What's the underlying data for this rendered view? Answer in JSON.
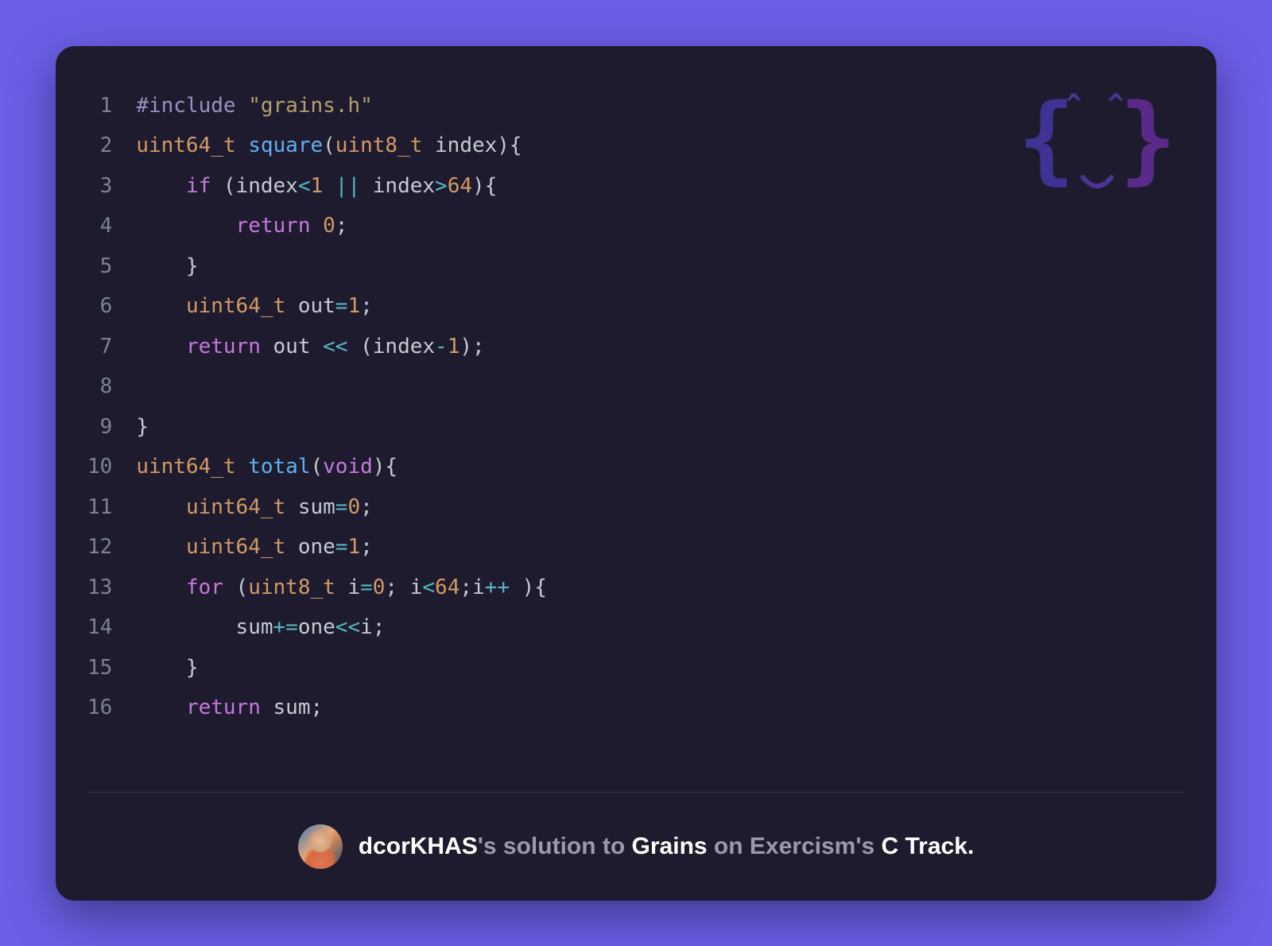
{
  "code": {
    "lines": [
      {
        "n": 1,
        "tokens": [
          [
            "#include ",
            "pre"
          ],
          [
            "\"grains.h\"",
            "str"
          ]
        ]
      },
      {
        "n": 2,
        "tokens": [
          [
            "uint64_t",
            "type"
          ],
          [
            " ",
            "punc"
          ],
          [
            "square",
            "func"
          ],
          [
            "(",
            "punc"
          ],
          [
            "uint8_t",
            "type"
          ],
          [
            " index){",
            "punc"
          ]
        ]
      },
      {
        "n": 3,
        "tokens": [
          [
            "    ",
            "punc"
          ],
          [
            "if",
            "key"
          ],
          [
            " (index",
            "punc"
          ],
          [
            "<",
            "op"
          ],
          [
            "1",
            "num"
          ],
          [
            " ",
            "punc"
          ],
          [
            "||",
            "op"
          ],
          [
            " index",
            "punc"
          ],
          [
            ">",
            "op"
          ],
          [
            "64",
            "num"
          ],
          [
            "){",
            "punc"
          ]
        ]
      },
      {
        "n": 4,
        "tokens": [
          [
            "        ",
            "punc"
          ],
          [
            "return",
            "key"
          ],
          [
            " ",
            "punc"
          ],
          [
            "0",
            "num"
          ],
          [
            ";",
            "punc"
          ]
        ]
      },
      {
        "n": 5,
        "tokens": [
          [
            "    }",
            "punc"
          ]
        ]
      },
      {
        "n": 6,
        "tokens": [
          [
            "    ",
            "punc"
          ],
          [
            "uint64_t",
            "type"
          ],
          [
            " out",
            "punc"
          ],
          [
            "=",
            "op"
          ],
          [
            "1",
            "num"
          ],
          [
            ";",
            "punc"
          ]
        ]
      },
      {
        "n": 7,
        "tokens": [
          [
            "    ",
            "punc"
          ],
          [
            "return",
            "key"
          ],
          [
            " out ",
            "punc"
          ],
          [
            "<<",
            "op"
          ],
          [
            " (index",
            "punc"
          ],
          [
            "-",
            "op"
          ],
          [
            "1",
            "num"
          ],
          [
            ");",
            "punc"
          ]
        ]
      },
      {
        "n": 8,
        "tokens": [
          [
            "",
            "punc"
          ]
        ]
      },
      {
        "n": 9,
        "tokens": [
          [
            "}",
            "punc"
          ]
        ]
      },
      {
        "n": 10,
        "tokens": [
          [
            "uint64_t",
            "type"
          ],
          [
            " ",
            "punc"
          ],
          [
            "total",
            "func"
          ],
          [
            "(",
            "punc"
          ],
          [
            "void",
            "key"
          ],
          [
            "){",
            "punc"
          ]
        ]
      },
      {
        "n": 11,
        "tokens": [
          [
            "    ",
            "punc"
          ],
          [
            "uint64_t",
            "type"
          ],
          [
            " sum",
            "punc"
          ],
          [
            "=",
            "op"
          ],
          [
            "0",
            "num"
          ],
          [
            ";",
            "punc"
          ]
        ]
      },
      {
        "n": 12,
        "tokens": [
          [
            "    ",
            "punc"
          ],
          [
            "uint64_t",
            "type"
          ],
          [
            " one",
            "punc"
          ],
          [
            "=",
            "op"
          ],
          [
            "1",
            "num"
          ],
          [
            ";",
            "punc"
          ]
        ]
      },
      {
        "n": 13,
        "tokens": [
          [
            "    ",
            "punc"
          ],
          [
            "for",
            "key"
          ],
          [
            " (",
            "punc"
          ],
          [
            "uint8_t",
            "type"
          ],
          [
            " i",
            "punc"
          ],
          [
            "=",
            "op"
          ],
          [
            "0",
            "num"
          ],
          [
            "; i",
            "punc"
          ],
          [
            "<",
            "op"
          ],
          [
            "64",
            "num"
          ],
          [
            ";i",
            "punc"
          ],
          [
            "++",
            "op"
          ],
          [
            " ){",
            "punc"
          ]
        ]
      },
      {
        "n": 14,
        "tokens": [
          [
            "        sum",
            "punc"
          ],
          [
            "+=",
            "op"
          ],
          [
            "one",
            "punc"
          ],
          [
            "<<",
            "op"
          ],
          [
            "i;",
            "punc"
          ]
        ]
      },
      {
        "n": 15,
        "tokens": [
          [
            "    }",
            "punc"
          ]
        ]
      },
      {
        "n": 16,
        "tokens": [
          [
            "    ",
            "punc"
          ],
          [
            "return",
            "key"
          ],
          [
            " sum;",
            "punc"
          ]
        ]
      }
    ]
  },
  "footer": {
    "user": "dcorKHAS",
    "sep1": "'s ",
    "w_solution": "solution to ",
    "exercise": "Grains",
    "w_on": " on ",
    "site": "Exercism",
    "sep2": "'s ",
    "track": "C Track."
  }
}
